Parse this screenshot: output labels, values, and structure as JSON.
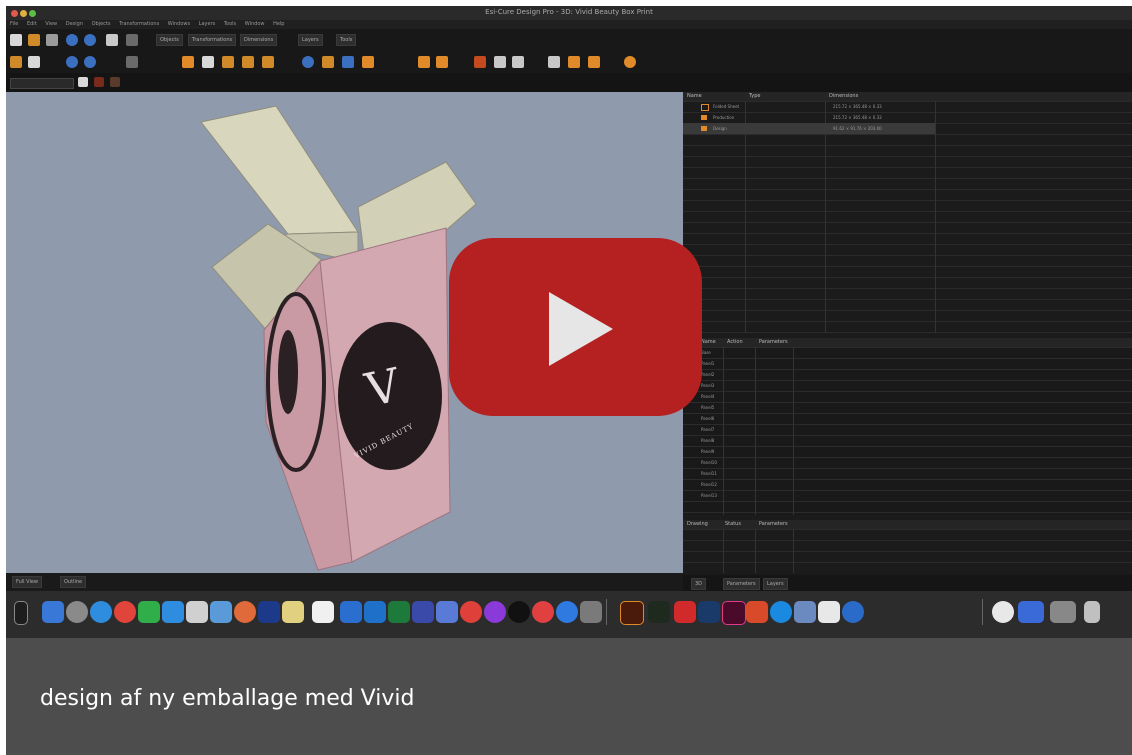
{
  "window": {
    "title": "Esi-Cure Design Pro - 3D: Vivid Beauty Box Print",
    "menu": [
      "File",
      "Edit",
      "View",
      "Design",
      "Objects",
      "Transformations",
      "Windows",
      "Layers",
      "Tools",
      "Window",
      "Help"
    ]
  },
  "toolbar": {
    "tabs": [
      "Objects",
      "Transformations",
      "Dimensions",
      "Layers",
      "Tools"
    ]
  },
  "viewport": {
    "logo_text": "VIVID BEAUTY",
    "bottom_tabs": [
      "Full View",
      "Outline"
    ]
  },
  "panels": {
    "top": {
      "headers": [
        "Name",
        "Type",
        "Dimensions"
      ],
      "rows": [
        {
          "name": "Folded Sheet",
          "dim": "215.72 × 365.48 × 0.33"
        },
        {
          "name": "Production",
          "dim": "215.72 × 365.48 × 0.33"
        },
        {
          "name": "Design",
          "dim": "91.62 × 91.76 × 203.00"
        }
      ]
    },
    "middle": {
      "headers": [
        "Name",
        "Action",
        "Parameters"
      ],
      "rows": [
        "Base",
        "Panel1",
        "Panel2",
        "Panel3",
        "Panel4",
        "Panel5",
        "Panel6",
        "Panel7",
        "Panel8",
        "Panel9",
        "Panel10",
        "Panel11",
        "Panel12",
        "Panel13"
      ]
    },
    "bottom": {
      "headers": [
        "Drawing",
        "Status",
        "Parameters"
      ],
      "tabs": [
        "3D",
        "Parameters",
        "Layers"
      ]
    }
  },
  "dock": {
    "icons": [
      "finder-icon",
      "launchpad-icon",
      "safari-icon",
      "chrome-icon",
      "facetime-icon",
      "messages-icon",
      "maps-icon",
      "photos-icon",
      "contacts-icon",
      "notes-icon",
      "reminders-icon",
      "calendar-icon",
      "outlook-icon",
      "excel-icon",
      "teams-icon",
      "music-icon",
      "podcasts-icon",
      "tv-icon",
      "news-icon",
      "appstore-icon",
      "settings-icon",
      "illustrator-icon",
      "terminal-icon",
      "acrobat-icon",
      "photoshop-icon",
      "indesign-icon",
      "powerpoint-icon",
      "edge-icon",
      "preview-icon",
      "zoom-icon",
      "quicktime-icon",
      "zoom2-icon",
      "keyboard-icon",
      "folder-icon",
      "trash-icon"
    ]
  },
  "video": {
    "play_label": "play-icon",
    "caption": "design af ny emballage med Vivid"
  }
}
